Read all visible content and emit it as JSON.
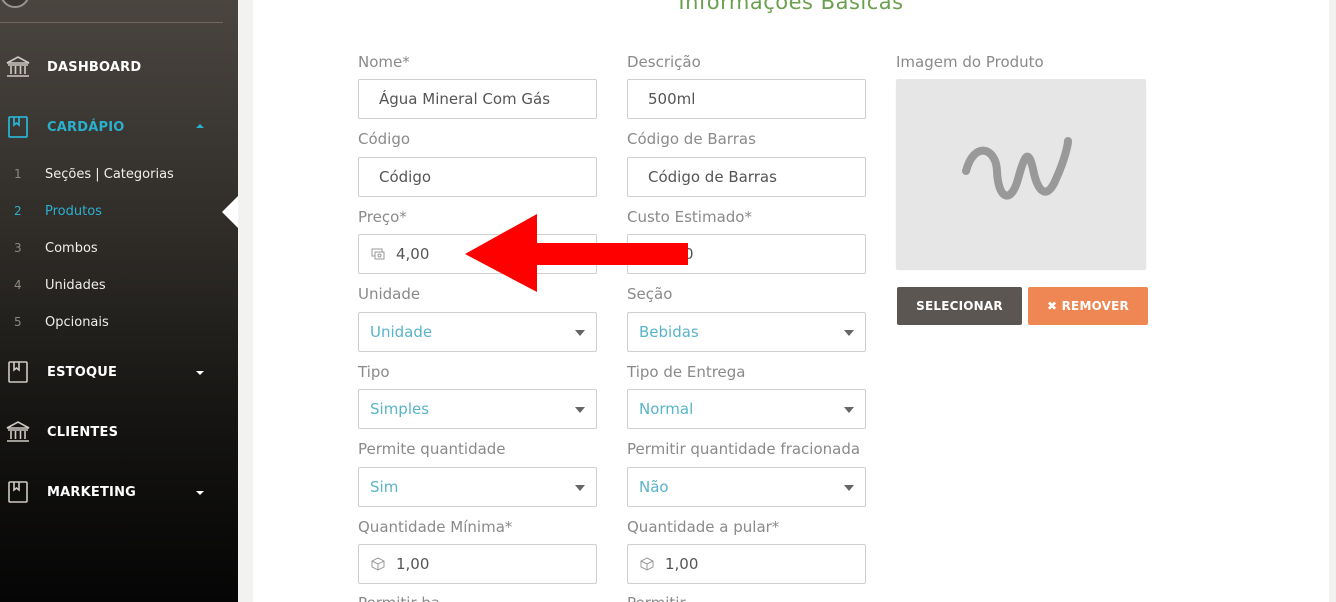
{
  "sidebar": {
    "menu": [
      {
        "label": "DASHBOARD",
        "icon": "bank-icon"
      },
      {
        "label": "CARDÁPIO",
        "icon": "book-icon",
        "active": true
      },
      {
        "label": "ESTOQUE",
        "icon": "book-icon"
      },
      {
        "label": "CLIENTES",
        "icon": "bank-icon"
      },
      {
        "label": "MARKETING",
        "icon": "book-icon"
      }
    ],
    "submenu": [
      {
        "num": "1",
        "label": "Seções | Categorias"
      },
      {
        "num": "2",
        "label": "Produtos",
        "active": true
      },
      {
        "num": "3",
        "label": "Combos"
      },
      {
        "num": "4",
        "label": "Unidades"
      },
      {
        "num": "5",
        "label": "Opcionais"
      }
    ]
  },
  "form": {
    "section_title": "Informações Básicas",
    "nome": {
      "label": "Nome*",
      "value": "Água Mineral Com Gás"
    },
    "descricao": {
      "label": "Descrição",
      "value": "500ml"
    },
    "codigo": {
      "label": "Código",
      "value": "Código"
    },
    "codigo_barras": {
      "label": "Código de Barras",
      "value": "Código de Barras"
    },
    "preco": {
      "label": "Preço*",
      "value": "4,00"
    },
    "custo": {
      "label": "Custo Estimado*",
      "value": "0"
    },
    "unidade": {
      "label": "Unidade",
      "value": "Unidade"
    },
    "secao": {
      "label": "Seção",
      "value": "Bebidas"
    },
    "tipo": {
      "label": "Tipo",
      "value": "Simples"
    },
    "tipo_entrega": {
      "label": "Tipo de Entrega",
      "value": "Normal"
    },
    "permite_qtd": {
      "label": "Permite quantidade",
      "value": "Sim"
    },
    "permite_frac": {
      "label": "Permitir quantidade fracionada",
      "value": "Não"
    },
    "qtd_minima": {
      "label": "Quantidade Mínima*",
      "value": "1,00"
    },
    "qtd_pular": {
      "label": "Quantidade a pular*",
      "value": "1,00"
    },
    "cut_left": "Permitir ba...",
    "cut_right": "Permitir..."
  },
  "image": {
    "label": "Imagem do Produto",
    "select_label": "SELECIONAR",
    "remove_label": "✖ REMOVER"
  },
  "colors": {
    "accent": "#2ab0cf",
    "title": "#6ba14e",
    "select_value": "#58b4c8",
    "remove_button": "#ee8754",
    "select_button": "#5b5652",
    "arrow": "#ff0000"
  }
}
